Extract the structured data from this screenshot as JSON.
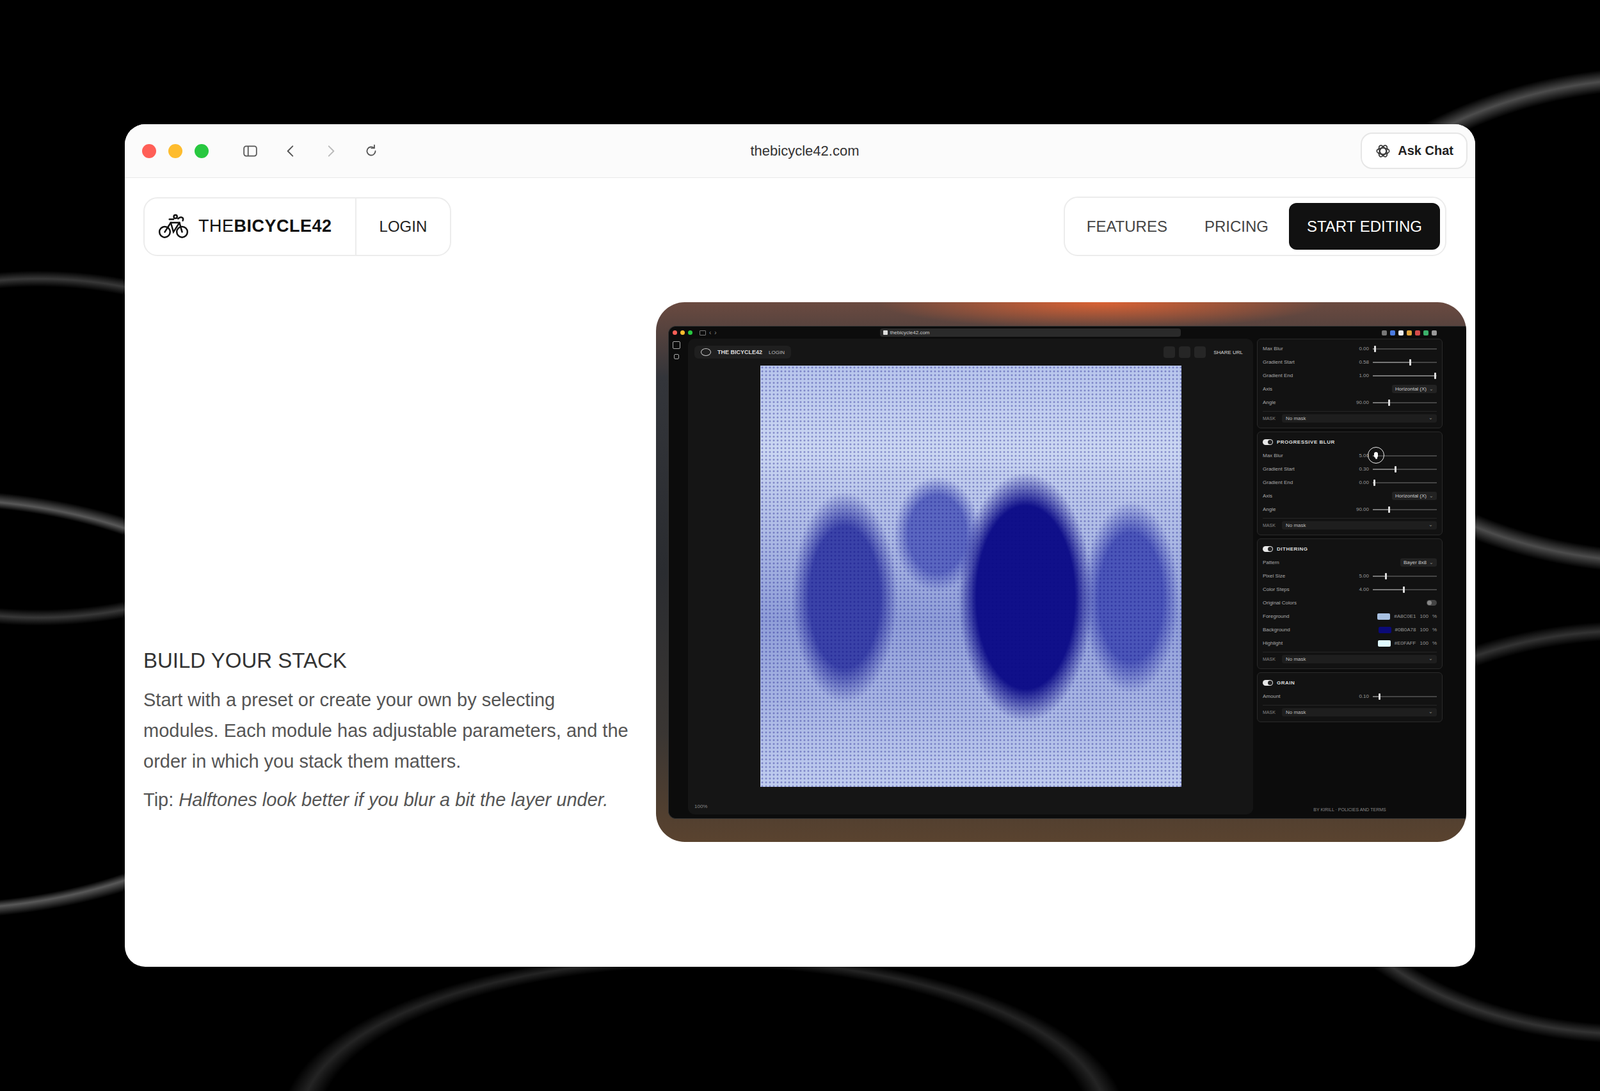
{
  "browser": {
    "url": "thebicycle42.com",
    "ask_button": "Ask Chat",
    "back_disabled": false,
    "forward_disabled": true
  },
  "nav": {
    "brand_light": "THE",
    "brand_bold": "BICYCLE42",
    "login": "LOGIN",
    "links": [
      {
        "label": "FEATURES",
        "kind": "link"
      },
      {
        "label": "PRICING",
        "kind": "link"
      },
      {
        "label": "START EDITING",
        "kind": "primary"
      }
    ]
  },
  "section": {
    "heading": "BUILD YOUR STACK",
    "body": "Start with a preset or create your own by selecting modules. Each module has adjustable parameters, and the order in which you stack them matters.",
    "tip_label": "Tip:",
    "tip_text": "Halftones look better if you blur a bit the layer under."
  },
  "preview": {
    "url": "thebicycle42.com",
    "brand": "THE BICYCLE42",
    "login": "LOGIN",
    "share": "SHARE URL",
    "zoom": "100%",
    "footer": "BY KIRILL · POLICIES AND TERMS",
    "modules": [
      {
        "rows": [
          {
            "kind": "slider",
            "label": "Max Blur",
            "value": "0.00",
            "level": 0.03,
            "hovered": false
          },
          {
            "kind": "slider",
            "label": "Gradient Start",
            "value": "0.58",
            "level": 0.58,
            "hovered": false
          },
          {
            "kind": "slider",
            "label": "Gradient End",
            "value": "1.00",
            "level": 0.97,
            "hovered": false
          },
          {
            "kind": "select",
            "label": "Axis",
            "value": "Horizontal (X)"
          },
          {
            "kind": "slider",
            "label": "Angle",
            "value": "90.00",
            "level": 0.25,
            "hovered": false
          }
        ],
        "mask_label": "MASK",
        "mask_value": "No mask"
      },
      {
        "title": "PROGRESSIVE BLUR",
        "on": true,
        "rows": [
          {
            "kind": "slider",
            "label": "Max Blur",
            "value": "5.00",
            "level": 0.05,
            "hovered": true
          },
          {
            "kind": "slider",
            "label": "Gradient Start",
            "value": "0.30",
            "level": 0.35,
            "hovered": false
          },
          {
            "kind": "slider",
            "label": "Gradient End",
            "value": "0.00",
            "level": 0.02,
            "hovered": false
          },
          {
            "kind": "select",
            "label": "Axis",
            "value": "Horizontal (X)"
          },
          {
            "kind": "slider",
            "label": "Angle",
            "value": "90.00",
            "level": 0.25,
            "hovered": false
          }
        ],
        "mask_label": "MASK",
        "mask_value": "No mask"
      },
      {
        "title": "DITHERING",
        "on": true,
        "rows": [
          {
            "kind": "select",
            "label": "Pattern",
            "value": "Bayer 8x8"
          },
          {
            "kind": "slider",
            "label": "Pixel Size",
            "value": "5.00",
            "level": 0.2,
            "hovered": false
          },
          {
            "kind": "slider",
            "label": "Color Steps",
            "value": "4.00",
            "level": 0.48,
            "hovered": false
          },
          {
            "kind": "toggle",
            "label": "Original Colors",
            "on": false
          },
          {
            "kind": "color",
            "label": "Foreground",
            "hex": "#A8C0E1",
            "color": "#a8c0e1",
            "opacity": "100",
            "unit": "%"
          },
          {
            "kind": "color",
            "label": "Background",
            "hex": "#0B0A78",
            "color": "#0b0a78",
            "opacity": "100",
            "unit": "%"
          },
          {
            "kind": "color",
            "label": "Highlight",
            "hex": "#E0FAFF",
            "color": "#e0faff",
            "opacity": "100",
            "unit": "%"
          }
        ],
        "mask_label": "MASK",
        "mask_value": "No mask"
      },
      {
        "title": "GRAIN",
        "on": true,
        "rows": [
          {
            "kind": "slider",
            "label": "Amount",
            "value": "0.10",
            "level": 0.1,
            "hovered": false
          }
        ],
        "mask_label": "MASK",
        "mask_value": "No mask"
      }
    ]
  }
}
